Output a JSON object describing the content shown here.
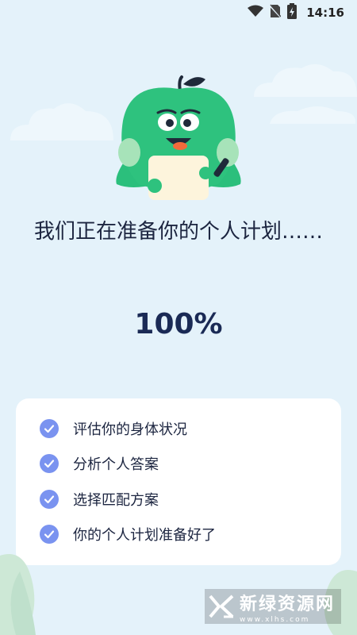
{
  "status_bar": {
    "time": "14:16"
  },
  "title": "我们正在准备你的个人计划……",
  "progress": {
    "label": "100%",
    "value": 100
  },
  "steps": [
    {
      "label": "评估你的身体状况",
      "done": true
    },
    {
      "label": "分析个人答案",
      "done": true
    },
    {
      "label": "选择匹配方案",
      "done": true
    },
    {
      "label": "你的个人计划准备好了",
      "done": true
    }
  ],
  "watermark": {
    "text": "新绿资源网",
    "sub": "www.xlhs.com"
  },
  "colors": {
    "background": "#e4f2fa",
    "mascot": "#2ec27e",
    "check": "#7a93f0",
    "card": "#ffffff"
  },
  "icons": [
    "wifi-icon",
    "no-sim-icon",
    "battery-icon",
    "check-icon"
  ]
}
